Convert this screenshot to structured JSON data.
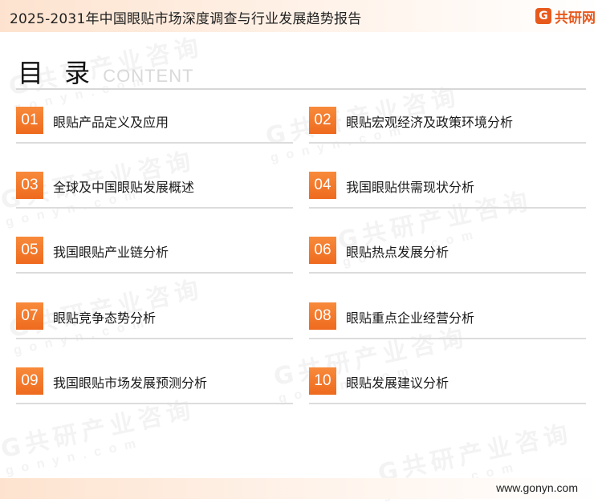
{
  "header": {
    "title": "2025-2031年中国眼贴市场深度调查与行业发展趋势报告",
    "logo_mark": "G",
    "logo_text": "共研网"
  },
  "toc": {
    "heading_cn": "目 录",
    "heading_en": "CONTENT",
    "items": [
      {
        "num": "01",
        "label": "眼贴产品定义及应用"
      },
      {
        "num": "02",
        "label": "眼贴宏观经济及政策环境分析"
      },
      {
        "num": "03",
        "label": "全球及中国眼贴发展概述"
      },
      {
        "num": "04",
        "label": "我国眼贴供需现状分析"
      },
      {
        "num": "05",
        "label": "我国眼贴产业链分析"
      },
      {
        "num": "06",
        "label": "眼贴热点发展分析"
      },
      {
        "num": "07",
        "label": "眼贴竞争态势分析"
      },
      {
        "num": "08",
        "label": "眼贴重点企业经营分析"
      },
      {
        "num": "09",
        "label": "我国眼贴市场发展预测分析"
      },
      {
        "num": "10",
        "label": "眼贴发展建议分析"
      }
    ]
  },
  "footer": {
    "url": "www.gonyn.com"
  },
  "colors": {
    "accent": "#ee6a1e",
    "header_bg": "#fde3cf"
  }
}
